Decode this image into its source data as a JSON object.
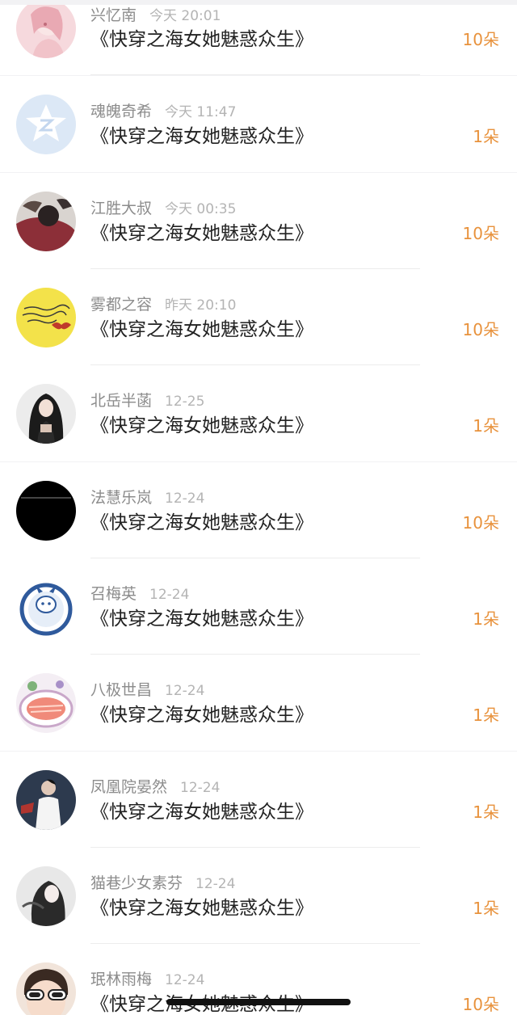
{
  "list": {
    "items": [
      {
        "name": "兴忆南",
        "time": "今天 20:01",
        "book": "《快穿之海女她魅惑众生》",
        "gift": "10朵",
        "avatar_icon": "pink-anime-girl-avatar-icon"
      },
      {
        "name": "魂魄奇希",
        "time": "今天 11:47",
        "book": "《快穿之海女她魅惑众生》",
        "gift": "1朵",
        "avatar_icon": "default-star-avatar-icon"
      },
      {
        "name": "江胜大叔",
        "time": "今天 00:35",
        "book": "《快穿之海女她魅惑众生》",
        "gift": "10朵",
        "avatar_icon": "person-lying-avatar-icon"
      },
      {
        "name": "雾都之容",
        "time": "昨天 20:10",
        "book": "《快穿之海女她魅惑众生》",
        "gift": "10朵",
        "avatar_icon": "yellow-handwriting-avatar-icon"
      },
      {
        "name": "北岳半菡",
        "time": "12-25",
        "book": "《快穿之海女她魅惑众生》",
        "gift": "1朵",
        "avatar_icon": "dark-hair-girl-avatar-icon"
      },
      {
        "name": "法慧乐岚",
        "time": "12-24",
        "book": "《快穿之海女她魅惑众生》",
        "gift": "10朵",
        "avatar_icon": "black-text-avatar-icon"
      },
      {
        "name": "召梅英",
        "time": "12-24",
        "book": "《快穿之海女她魅惑众生》",
        "gift": "1朵",
        "avatar_icon": "blue-porcelain-avatar-icon"
      },
      {
        "name": "八极世昌",
        "time": "12-24",
        "book": "《快穿之海女她魅惑众生》",
        "gift": "1朵",
        "avatar_icon": "food-plate-avatar-icon"
      },
      {
        "name": "凤凰院晏然",
        "time": "12-24",
        "book": "《快穿之海女她魅惑众生》",
        "gift": "1朵",
        "avatar_icon": "man-in-shirt-avatar-icon"
      },
      {
        "name": "猫巷少女素芬",
        "time": "12-24",
        "book": "《快穿之海女她魅惑众生》",
        "gift": "1朵",
        "avatar_icon": "monochrome-girl-avatar-icon"
      },
      {
        "name": "珉林雨梅",
        "time": "12-24",
        "book": "《快穿之海女她魅惑众生》",
        "gift": "10朵",
        "avatar_icon": "sunglasses-child-avatar-icon"
      }
    ]
  },
  "colors": {
    "gift": "#e8923c",
    "title": "#222222",
    "name": "#8c8c8c",
    "time": "#b4b4b4",
    "background": "#f2f2f4"
  }
}
